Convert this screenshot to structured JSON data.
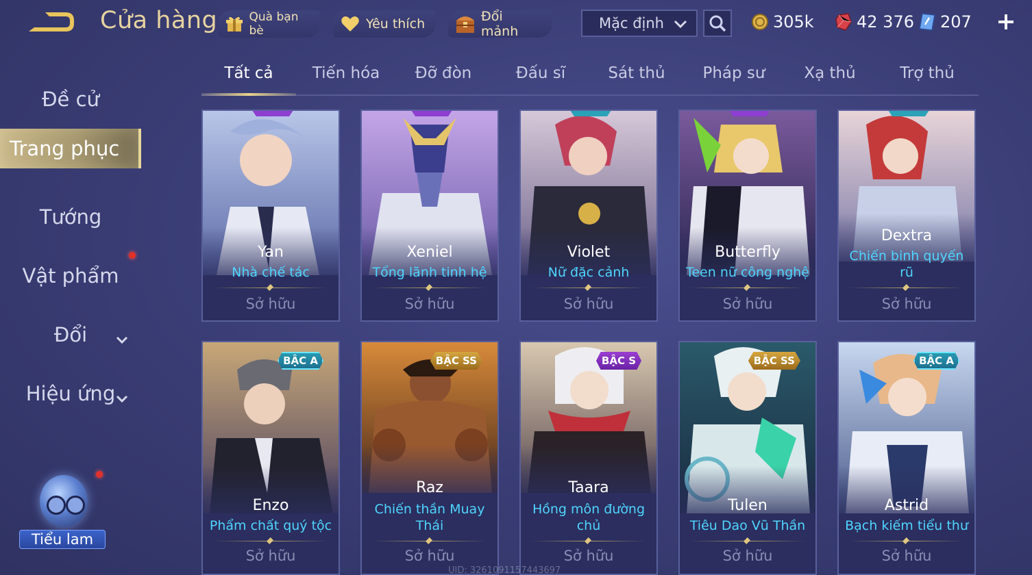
{
  "header": {
    "title": "Cửa hàng",
    "gift_label": "Quà bạn bè",
    "favorite_label": "Yêu thích",
    "shard_label": "Đổi mảnh",
    "sort_value": "Mặc định",
    "gold_amount": "305k",
    "gem_amount": "42 376",
    "voucher_amount": "207"
  },
  "sidebar": {
    "items": [
      {
        "label": "Đề cử"
      },
      {
        "label": "Trang phục"
      },
      {
        "label": "Tướng"
      },
      {
        "label": "Vật phẩm"
      },
      {
        "label": "Đổi"
      },
      {
        "label": "Hiệu ứng"
      }
    ],
    "assistant_label": "Tiểu lam"
  },
  "tabs": [
    "Tất cả",
    "Tiến hóa",
    "Đỡ đòn",
    "Đấu sĩ",
    "Sát thủ",
    "Pháp sư",
    "Xạ thủ",
    "Trợ thủ"
  ],
  "cards": [
    {
      "hero": "Yan",
      "skin": "Nhà chế tác",
      "status": "Sở hữu",
      "tier": ""
    },
    {
      "hero": "Xeniel",
      "skin": "Tổng lãnh tinh hệ",
      "status": "Sở hữu",
      "tier": ""
    },
    {
      "hero": "Violet",
      "skin": "Nữ đặc cảnh",
      "status": "Sở hữu",
      "tier": ""
    },
    {
      "hero": "Butterfly",
      "skin": "Teen nữ công nghệ",
      "status": "Sở hữu",
      "tier": ""
    },
    {
      "hero": "Dextra",
      "skin": "Chiến binh quyến rũ",
      "status": "Sở hữu",
      "tier": ""
    },
    {
      "hero": "Enzo",
      "skin": "Phẩm chất quý tộc",
      "status": "Sở hữu",
      "tier": "BẬC A"
    },
    {
      "hero": "Raz",
      "skin": "Chiến thần Muay Thái",
      "status": "Sở hữu",
      "tier": "BẬC SS"
    },
    {
      "hero": "Taara",
      "skin": "Hồng môn đường chủ",
      "status": "Sở hữu",
      "tier": "BẬC S"
    },
    {
      "hero": "Tulen",
      "skin": "Tiêu Dao Vũ Thần",
      "status": "Sở hữu",
      "tier": "BẬC SS"
    },
    {
      "hero": "Astrid",
      "skin": "Bạch kiếm tiểu thư",
      "status": "Sở hữu",
      "tier": "BẬC A"
    }
  ],
  "footer": {
    "uid": "UID: 3261091157443697"
  },
  "colors": {
    "accent_gold": "#e6d3a0",
    "skin_name": "#4fd5ff",
    "background": "#3c3f78"
  }
}
